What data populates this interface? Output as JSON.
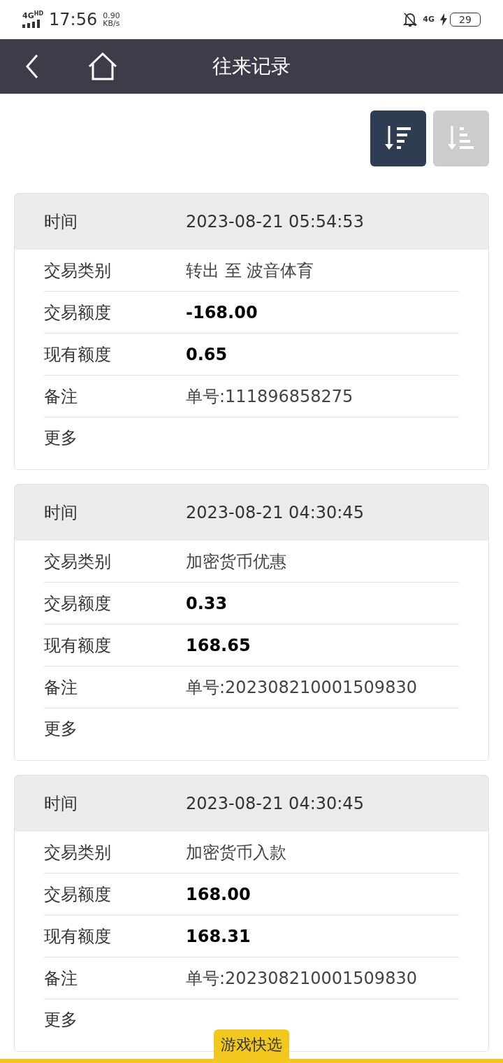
{
  "status_bar": {
    "network": "4G",
    "network_badge": "HD",
    "time": "17:56",
    "speed": "0.90",
    "speed_unit": "KB/s",
    "network_right": "4G",
    "battery": "29"
  },
  "nav": {
    "title": "往来记录"
  },
  "sort_buttons": [
    {
      "kind": "desc",
      "selected": true
    },
    {
      "kind": "asc",
      "selected": false
    }
  ],
  "records": [
    {
      "time_label": "时间",
      "time": "2023-08-21 05:54:53",
      "fields": [
        {
          "label": "交易类别",
          "value": "转出 至 波音体育",
          "kind": "text"
        },
        {
          "label": "交易额度",
          "value": "-168.00",
          "kind": "amount"
        },
        {
          "label": "现有额度",
          "value": "0.65",
          "kind": "amount"
        },
        {
          "label": "备注",
          "value": "单号:111896858275",
          "kind": "text"
        }
      ],
      "more": "更多"
    },
    {
      "time_label": "时间",
      "time": "2023-08-21 04:30:45",
      "fields": [
        {
          "label": "交易类别",
          "value": "加密货币优惠",
          "kind": "text"
        },
        {
          "label": "交易额度",
          "value": "0.33",
          "kind": "amount"
        },
        {
          "label": "现有额度",
          "value": "168.65",
          "kind": "amount"
        },
        {
          "label": "备注",
          "value": "单号:202308210001509830",
          "kind": "text"
        }
      ],
      "more": "更多"
    },
    {
      "time_label": "时间",
      "time": "2023-08-21 04:30:45",
      "fields": [
        {
          "label": "交易类别",
          "value": "加密货币入款",
          "kind": "text"
        },
        {
          "label": "交易额度",
          "value": "168.00",
          "kind": "amount"
        },
        {
          "label": "现有额度",
          "value": "168.31",
          "kind": "amount"
        },
        {
          "label": "备注",
          "value": "单号:202308210001509830",
          "kind": "text"
        }
      ],
      "more": "更多"
    }
  ],
  "quick_pick": {
    "label": "游戏快选"
  }
}
